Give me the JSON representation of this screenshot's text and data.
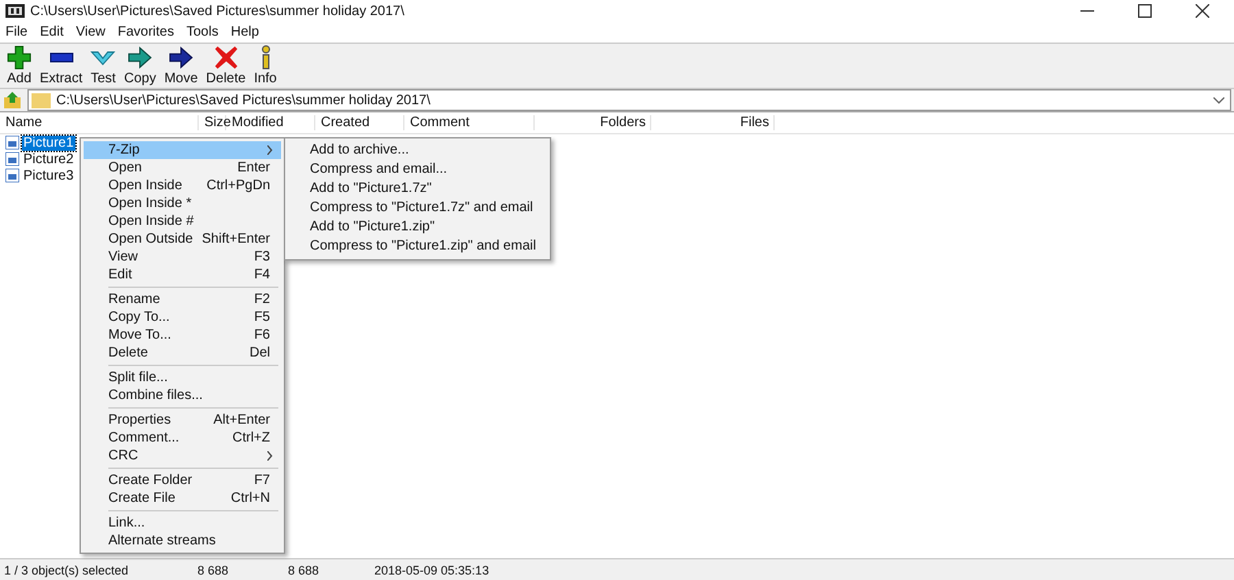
{
  "window": {
    "title": "C:\\Users\\User\\Pictures\\Saved Pictures\\summer holiday 2017\\"
  },
  "menu_bar": [
    "File",
    "Edit",
    "View",
    "Favorites",
    "Tools",
    "Help"
  ],
  "toolbar": [
    {
      "kind": "add",
      "label": "Add"
    },
    {
      "kind": "extract",
      "label": "Extract"
    },
    {
      "kind": "test",
      "label": "Test"
    },
    {
      "kind": "copy",
      "label": "Copy"
    },
    {
      "kind": "move",
      "label": "Move"
    },
    {
      "kind": "delete",
      "label": "Delete"
    },
    {
      "kind": "info",
      "label": "Info"
    }
  ],
  "address": {
    "value": "C:\\Users\\User\\Pictures\\Saved Pictures\\summer holiday 2017\\"
  },
  "table": {
    "columns": [
      "Name",
      "Size",
      "Modified",
      "Created",
      "Comment",
      "Folders",
      "Files"
    ],
    "rows": [
      {
        "name": "Picture1",
        "selected": true
      },
      {
        "name": "Picture2",
        "selected": false
      },
      {
        "name": "Picture3",
        "selected": false
      }
    ]
  },
  "context_menu": [
    {
      "kind": "item",
      "label": "7-Zip",
      "submenu": true,
      "selected": true
    },
    {
      "kind": "item",
      "label": "Open",
      "shortcut": "Enter",
      "submenu": false,
      "selected": false
    },
    {
      "kind": "item",
      "label": "Open Inside",
      "shortcut": "Ctrl+PgDn",
      "submenu": false,
      "selected": false
    },
    {
      "kind": "item",
      "label": "Open Inside *",
      "submenu": false,
      "selected": false
    },
    {
      "kind": "item",
      "label": "Open Inside #",
      "submenu": false,
      "selected": false
    },
    {
      "kind": "item",
      "label": "Open Outside",
      "shortcut": "Shift+Enter",
      "submenu": false,
      "selected": false
    },
    {
      "kind": "item",
      "label": "View",
      "shortcut": "F3",
      "submenu": false,
      "selected": false
    },
    {
      "kind": "item",
      "label": "Edit",
      "shortcut": "F4",
      "submenu": false,
      "selected": false
    },
    {
      "kind": "separator"
    },
    {
      "kind": "item",
      "label": "Rename",
      "shortcut": "F2",
      "submenu": false,
      "selected": false
    },
    {
      "kind": "item",
      "label": "Copy To...",
      "shortcut": "F5",
      "submenu": false,
      "selected": false
    },
    {
      "kind": "item",
      "label": "Move To...",
      "shortcut": "F6",
      "submenu": false,
      "selected": false
    },
    {
      "kind": "item",
      "label": "Delete",
      "shortcut": "Del",
      "submenu": false,
      "selected": false
    },
    {
      "kind": "separator"
    },
    {
      "kind": "item",
      "label": "Split file...",
      "submenu": false,
      "selected": false
    },
    {
      "kind": "item",
      "label": "Combine files...",
      "submenu": false,
      "selected": false
    },
    {
      "kind": "separator"
    },
    {
      "kind": "item",
      "label": "Properties",
      "shortcut": "Alt+Enter",
      "submenu": false,
      "selected": false
    },
    {
      "kind": "item",
      "label": "Comment...",
      "shortcut": "Ctrl+Z",
      "submenu": false,
      "selected": false
    },
    {
      "kind": "item",
      "label": "CRC",
      "submenu": true,
      "selected": false
    },
    {
      "kind": "separator"
    },
    {
      "kind": "item",
      "label": "Create Folder",
      "shortcut": "F7",
      "submenu": false,
      "selected": false
    },
    {
      "kind": "item",
      "label": "Create File",
      "shortcut": "Ctrl+N",
      "submenu": false,
      "selected": false
    },
    {
      "kind": "separator"
    },
    {
      "kind": "item",
      "label": "Link...",
      "submenu": false,
      "selected": false
    },
    {
      "kind": "item",
      "label": "Alternate streams",
      "submenu": false,
      "selected": false
    }
  ],
  "submenu": [
    "Add to archive...",
    "Compress and email...",
    "Add to \"Picture1.7z\"",
    "Compress to \"Picture1.7z\" and email",
    "Add to \"Picture1.zip\"",
    "Compress to \"Picture1.zip\" and email"
  ],
  "status_bar": [
    "1 / 3 object(s) selected",
    "8 688",
    "8 688",
    "2018-05-09 05:35:13"
  ]
}
